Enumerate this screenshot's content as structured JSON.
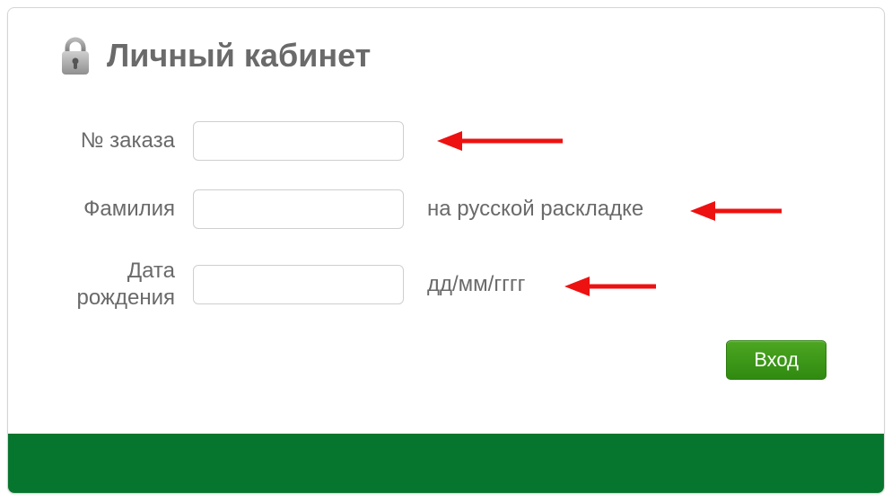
{
  "header": {
    "title": "Личный кабинет"
  },
  "form": {
    "order_label": "№ заказа",
    "order_value": "",
    "surname_label": "Фамилия",
    "surname_value": "",
    "surname_hint": "на русской раскладке",
    "dob_label": "Дата рождения",
    "dob_value": "",
    "dob_hint": "дд/мм/гггг",
    "submit_label": "Вход"
  }
}
